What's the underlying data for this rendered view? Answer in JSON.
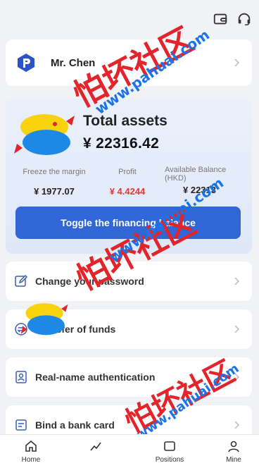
{
  "header": {
    "wallet_icon": "wallet-icon",
    "support_icon": "headset-icon"
  },
  "user": {
    "name": "Mr. Chen",
    "logo_icon": "app-logo-icon"
  },
  "assets": {
    "title": "Total assets",
    "total": "¥  22316.42",
    "stats": [
      {
        "label": "Freeze the margin",
        "value": "¥ 1977.07"
      },
      {
        "label": "Profit",
        "value": "¥ 4.4244"
      },
      {
        "label": "Available Balance (HKD)",
        "value": "¥ 22313"
      }
    ],
    "toggle_label": "Toggle the financing balance",
    "accent_color": "#3066d6",
    "profit_color": "#e53935"
  },
  "menu": [
    {
      "label": "Change your password",
      "icon": "edit-icon"
    },
    {
      "label": "Transfer of funds",
      "icon": "transfer-icon"
    },
    {
      "label": "Real-name authentication",
      "icon": "id-card-icon"
    },
    {
      "label": "Bind a bank card",
      "icon": "bank-card-icon"
    }
  ],
  "tabbar": [
    {
      "label": "Home",
      "icon": "home-icon"
    },
    {
      "label": "",
      "icon": "market-icon"
    },
    {
      "label": "Positions",
      "icon": "positions-icon"
    },
    {
      "label": "Mine",
      "icon": "user-icon"
    }
  ],
  "watermark": {
    "cn": "怕坏社区",
    "url": "www.pahuai.com"
  }
}
